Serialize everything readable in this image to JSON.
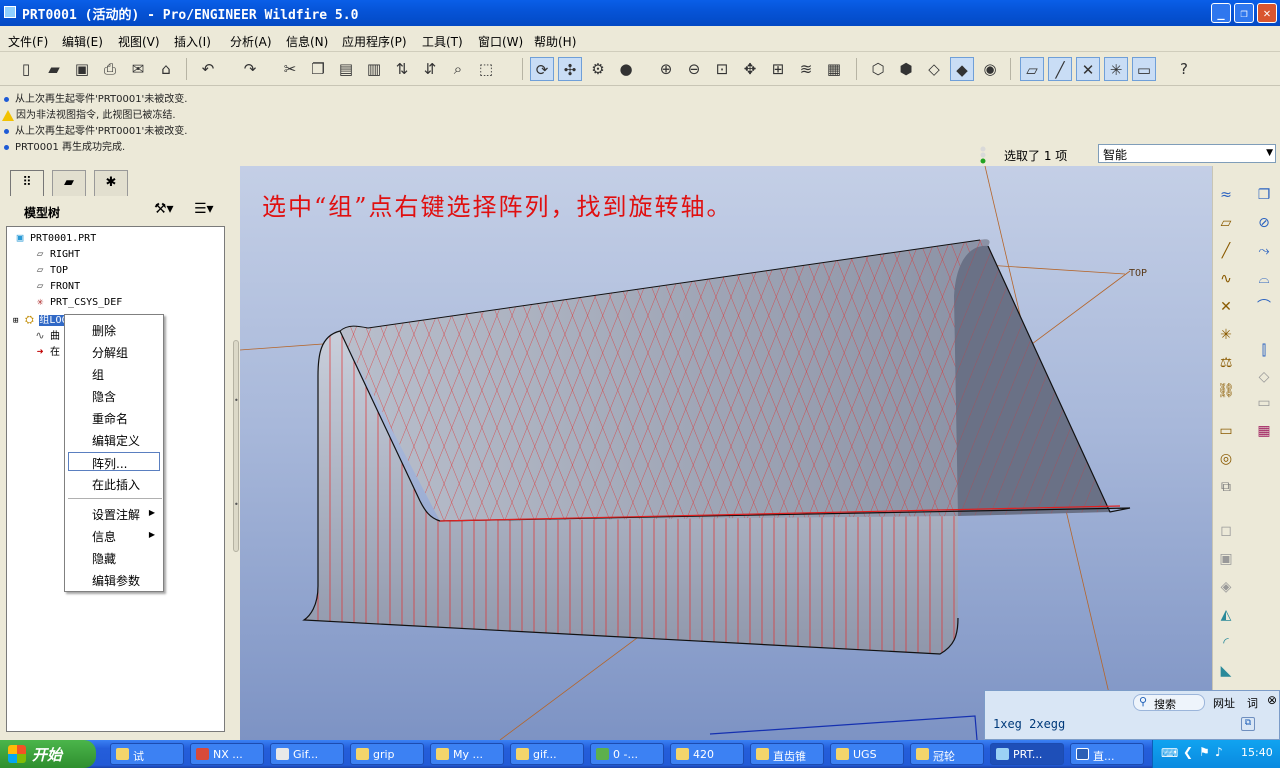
{
  "window": {
    "title": "PRT0001 (活动的) - Pro/ENGINEER Wildfire 5.0",
    "controls": {
      "minimize": "_",
      "maximize": "❐",
      "close": "✕"
    }
  },
  "menubar": [
    "文件(F)",
    "编辑(E)",
    "视图(V)",
    "插入(I)",
    "分析(A)",
    "信息(N)",
    "应用程序(P)",
    "工具(T)",
    "窗口(W)",
    "帮助(H)"
  ],
  "messages": [
    {
      "icon": "info",
      "text": "从上次再生起零件'PRT0001'未被改变."
    },
    {
      "icon": "warning",
      "text": "因为非法视图指令, 此视图已被冻结."
    },
    {
      "icon": "info",
      "text": "从上次再生起零件'PRT0001'未被改变."
    },
    {
      "icon": "info",
      "text": "PRT0001 再生成功完成."
    }
  ],
  "selection": {
    "status": "选取了 1 项",
    "filter": "智能"
  },
  "model_tree": {
    "title": "模型树",
    "root": "PRT0001.PRT",
    "items": [
      "RIGHT",
      "TOP",
      "FRONT",
      "PRT_CSYS_DEF",
      "组LOCAL_GROUP",
      "曲",
      "在"
    ]
  },
  "context_menu": {
    "items": [
      "删除",
      "分解组",
      "组",
      "隐含",
      "重命名",
      "编辑定义",
      "阵列...",
      "在此插入",
      "设置注解",
      "信息",
      "隐藏",
      "编辑参数"
    ],
    "selected": "阵列..."
  },
  "annotation": "选中“组”点右键选择阵列，找到旋转轴。",
  "viewport": {
    "datum_label": "TOP",
    "surface_color": "#e02020",
    "edge_color": "#000000"
  },
  "findbar": {
    "search_label": "搜索",
    "address_label": "网址",
    "word_label": "词",
    "command": "1xeg 2xegg"
  },
  "taskbar": {
    "start": "开始",
    "tasks": [
      "试",
      "NX ...",
      "Gif...",
      "grip",
      "My ...",
      "gif...",
      "0 -...",
      "420",
      "直齿锥",
      "UGS",
      "冠轮",
      "PRT...",
      "直..."
    ],
    "active": "PRT...",
    "clock": "15:40"
  },
  "colors": {
    "titlebar": "#0654d8",
    "annotation": "#e01010",
    "taskbar": "#245edb",
    "start": "#2f8f2f"
  }
}
